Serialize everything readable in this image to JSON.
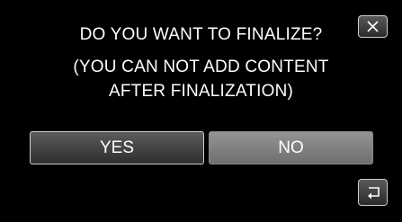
{
  "dialog": {
    "question": "DO YOU WANT TO FINALIZE?",
    "note_line1": "(YOU CAN NOT ADD CONTENT",
    "note_line2": "AFTER FINALIZATION)"
  },
  "buttons": {
    "yes_label": "YES",
    "no_label": "NO"
  },
  "icons": {
    "close": "close-icon",
    "back": "return-arrow-icon"
  },
  "colors": {
    "background": "#000000",
    "text": "#ffffff",
    "selected_button": "#3a3a3a",
    "unselected_button": "#7f7f7f"
  }
}
